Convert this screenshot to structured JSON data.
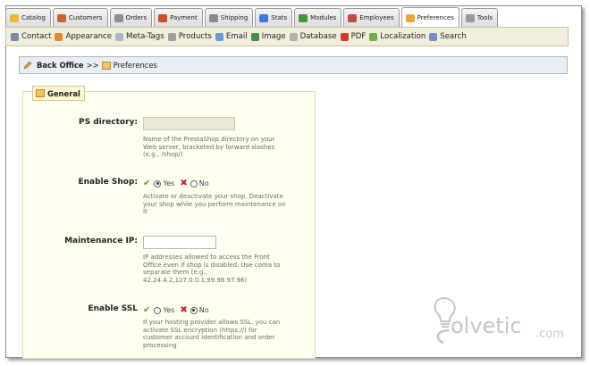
{
  "tabs": [
    {
      "label": "Catalog",
      "icon": "folder-icon",
      "color": "#f0b830"
    },
    {
      "label": "Customers",
      "icon": "user-icon",
      "color": "#c86432"
    },
    {
      "label": "Orders",
      "icon": "list-icon",
      "color": "#909090"
    },
    {
      "label": "Payment",
      "icon": "payment-icon",
      "color": "#d24a2a"
    },
    {
      "label": "Shipping",
      "icon": "truck-icon",
      "color": "#8a8a8a"
    },
    {
      "label": "Stats",
      "icon": "chart-icon",
      "color": "#3a7ad8"
    },
    {
      "label": "Modules",
      "icon": "puzzle-icon",
      "color": "#3c9a3c"
    },
    {
      "label": "Employees",
      "icon": "employees-icon",
      "color": "#c84a3a"
    },
    {
      "label": "Preferences",
      "icon": "preferences-icon",
      "color": "#f0a830",
      "active": true
    },
    {
      "label": "Tools",
      "icon": "tools-icon",
      "color": "#9a9a9a"
    }
  ],
  "subnav": [
    {
      "label": "Contact",
      "icon": "contact-icon",
      "color": "#7a8aa8"
    },
    {
      "label": "Appearance",
      "icon": "appearance-icon",
      "color": "#e08a30"
    },
    {
      "label": "Meta-Tags",
      "icon": "meta-tags-icon",
      "color": "#a8b8d0"
    },
    {
      "label": "Products",
      "icon": "products-icon",
      "color": "#a0a0a0"
    },
    {
      "label": "Email",
      "icon": "email-icon",
      "color": "#6a9ad0"
    },
    {
      "label": "Image",
      "icon": "image-icon",
      "color": "#4a8a4a"
    },
    {
      "label": "Database",
      "icon": "database-icon",
      "color": "#b0b0b0"
    },
    {
      "label": "PDF",
      "icon": "pdf-icon",
      "color": "#d23a2a"
    },
    {
      "label": "Localization",
      "icon": "localization-icon",
      "color": "#70b040"
    },
    {
      "label": "Search",
      "icon": "search-icon",
      "color": "#7090c0"
    }
  ],
  "breadcrumb": {
    "root": "Back Office",
    "sep": ">>",
    "current": "Preferences"
  },
  "section": {
    "legend": "General"
  },
  "fields": {
    "ps_directory": {
      "label": "PS directory:",
      "value": "",
      "help": [
        "Name of the PrestaShop directory on your",
        "Web server, bracketed by forward slashes",
        "(e.g., /shop/)"
      ]
    },
    "enable_shop": {
      "label": "Enable Shop:",
      "yes": "Yes",
      "no": "No",
      "selected": "Yes",
      "help": [
        "Activate or deactivate your shop. Deactivate",
        "your shop while you perform maintenance on",
        "it"
      ]
    },
    "maintenance_ip": {
      "label": "Maintenance IP:",
      "value": "",
      "help": [
        "IP addresses allowed to access the Front",
        "Office even if shop is disabled. Use coma to",
        "separate them (e.g.,",
        "42.24.4.2,127.0.0.1,99.98.97.96)"
      ]
    },
    "enable_ssl": {
      "label": "Enable SSL",
      "yes": "Yes",
      "no": "No",
      "selected": "No",
      "help": [
        "If your hosting provider allows SSL, you can",
        "activate SSL encryption (https://) for",
        "customer account identification and order",
        "processing"
      ]
    }
  },
  "watermark": {
    "text": "olvetic",
    "suffix": ".com"
  }
}
